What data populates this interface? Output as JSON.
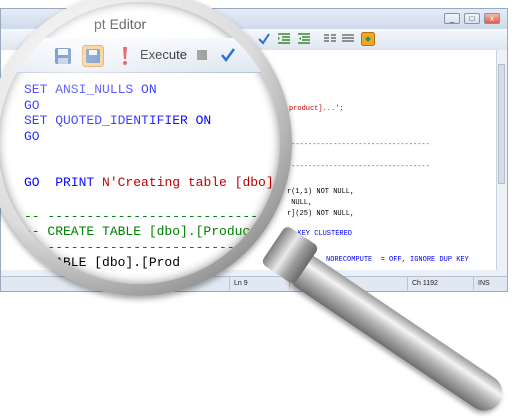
{
  "window": {
    "title": "pt Editor",
    "buttons": [
      "_",
      "□",
      "x"
    ]
  },
  "status_bar": {
    "line": "Ln 9",
    "column": "Ch 1192",
    "mode": "INS",
    "partial": "P"
  },
  "editor_right_lines": [
    "product]...';",
    "----------------------------------",
    "----------------------------------",
    "r(1,1) NOT NULL,",
    " NULL,",
    "r](25) NOT NULL,",
    "",
    "Y KEY CLUSTERED",
    "",
    ", STAT         NORECOMPUTE  = OFF, IGNORE DUP KEY"
  ],
  "magnified": {
    "toolbar": {
      "execute_label": "Execute"
    },
    "code_lines": [
      "SET ANSI_NULLS ON",
      "GO",
      "SET QUOTED_IDENTIFIER ON",
      "GO",
      "",
      "PRINT N'Creating table [dbo].[Pr",
      "GO",
      "",
      "-- -------------------------------",
      "-- CREATE TABLE [dbo].[Produc",
      "-- -------------------------------",
      "   TABLE [dbo].[Prod",
      "   duct]..."
    ]
  },
  "colors": {
    "keyword": "#0000ff",
    "string": "#c00000",
    "comment": "#008000",
    "text": "#000000"
  }
}
